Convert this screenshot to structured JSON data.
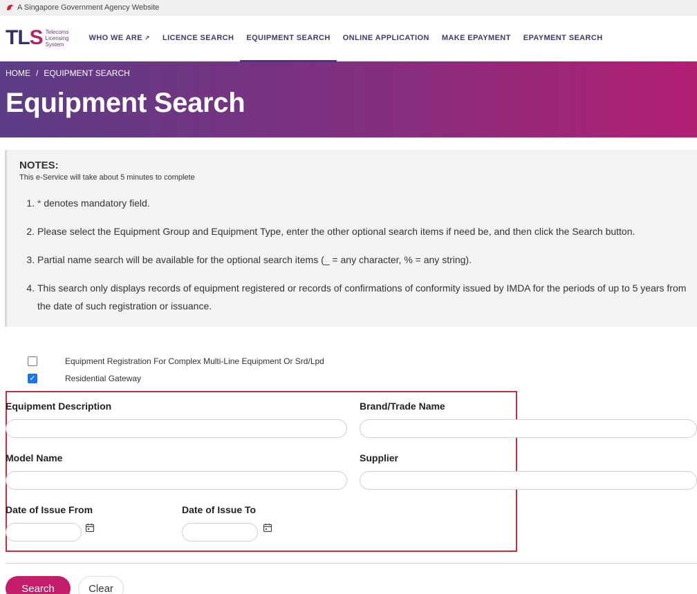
{
  "gov_bar": {
    "text": "A Singapore Government Agency Website"
  },
  "logo": {
    "mark_tl": "TL",
    "mark_s": "S",
    "sub_line1": "Telecoms",
    "sub_line2": "Licensing",
    "sub_line3": "System"
  },
  "nav": {
    "items": [
      {
        "label": "WHO WE ARE",
        "external": true
      },
      {
        "label": "LICENCE SEARCH"
      },
      {
        "label": "EQUIPMENT SEARCH",
        "active": true
      },
      {
        "label": "ONLINE APPLICATION"
      },
      {
        "label": "MAKE EPAYMENT"
      },
      {
        "label": "EPAYMENT SEARCH"
      }
    ],
    "external_glyph": "↗"
  },
  "breadcrumb": {
    "home": "HOME",
    "separator": "/",
    "current": "EQUIPMENT SEARCH"
  },
  "page_title": "Equipment Search",
  "notes": {
    "heading": "NOTES:",
    "subtitle": "This e-Service will take about 5 minutes to complete",
    "items": [
      {
        "star": "*",
        "text": " denotes mandatory field."
      },
      {
        "text": "Please select the Equipment Group and Equipment Type, enter the other optional search items if need be, and then click the Search button."
      },
      {
        "text": "Partial name search will be available for the optional search items (_ = any character, % = any string)."
      },
      {
        "text": "This search only displays records of equipment registered or records of confirmations of conformity issued by IMDA for the periods of up to 5 years from the date of such registration or issuance."
      }
    ]
  },
  "equipment_types": [
    {
      "label": "Equipment Registration For Complex Multi-Line Equipment Or Srd/Lpd",
      "checked": false
    },
    {
      "label": "Residential Gateway",
      "checked": true
    }
  ],
  "form": {
    "equipment_description": {
      "label": "Equipment Description",
      "value": ""
    },
    "brand_trade_name": {
      "label": "Brand/Trade Name",
      "value": ""
    },
    "model_name": {
      "label": "Model Name",
      "value": ""
    },
    "supplier": {
      "label": "Supplier",
      "value": ""
    },
    "date_from": {
      "label": "Date of Issue From",
      "value": ""
    },
    "date_to": {
      "label": "Date of Issue To",
      "value": ""
    }
  },
  "buttons": {
    "search": "Search",
    "clear": "Clear"
  },
  "colors": {
    "brand_purple": "#54317e",
    "brand_magenta": "#c41e6a",
    "highlight_border": "#c62d3a",
    "checkbox_blue": "#1a73e8"
  }
}
